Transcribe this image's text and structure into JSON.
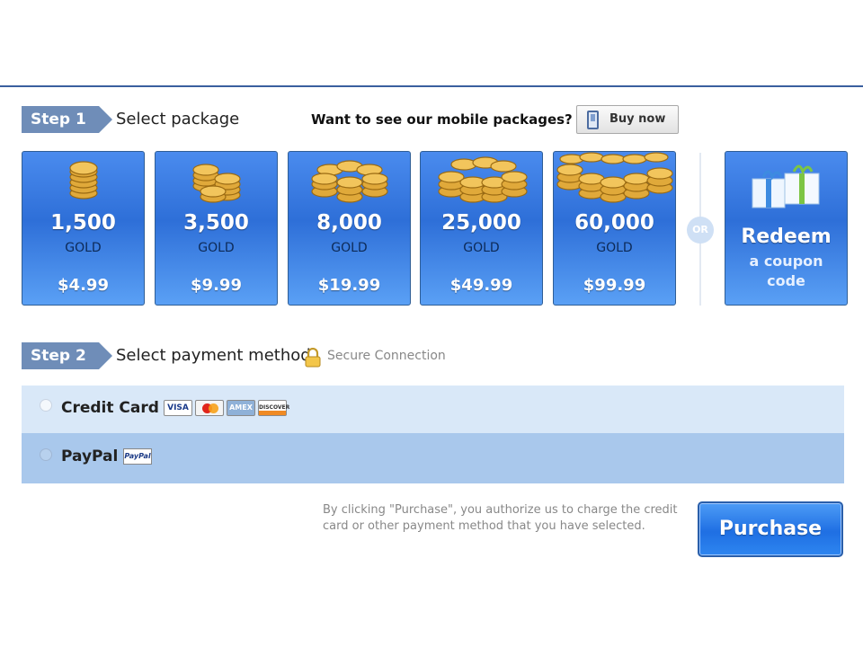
{
  "step1": {
    "tag": "Step 1",
    "title": "Select package",
    "mobile_question": "Want to see our mobile packages?",
    "buy_now_label": "Buy now"
  },
  "packages": [
    {
      "amount": "1,500",
      "unit": "GOLD",
      "price": "$4.99"
    },
    {
      "amount": "3,500",
      "unit": "GOLD",
      "price": "$9.99"
    },
    {
      "amount": "8,000",
      "unit": "GOLD",
      "price": "$19.99"
    },
    {
      "amount": "25,000",
      "unit": "GOLD",
      "price": "$49.99"
    },
    {
      "amount": "60,000",
      "unit": "GOLD",
      "price": "$99.99"
    }
  ],
  "or_label": "OR",
  "redeem": {
    "line1": "Redeem",
    "line2": "a coupon",
    "line3": "code"
  },
  "step2": {
    "tag": "Step 2",
    "title": "Select payment method",
    "secure_label": "Secure Connection"
  },
  "payment_methods": {
    "credit_card": {
      "label": "Credit Card",
      "card_logos": [
        "VISA",
        "MasterCard",
        "AMEX",
        "DISCOVER"
      ]
    },
    "paypal": {
      "label": "PayPal",
      "logo": "PayPal"
    }
  },
  "disclaimer": "By clicking \"Purchase\", you authorize us to charge the credit card or other payment method that you have selected.",
  "purchase_label": "Purchase",
  "colors": {
    "accent_blue": "#2e6fd8",
    "step_tag": "#6f8db8",
    "row_light": "#d9e8f8",
    "row_dark": "#a9c8ec",
    "coin_gold": "#e0a93a"
  }
}
